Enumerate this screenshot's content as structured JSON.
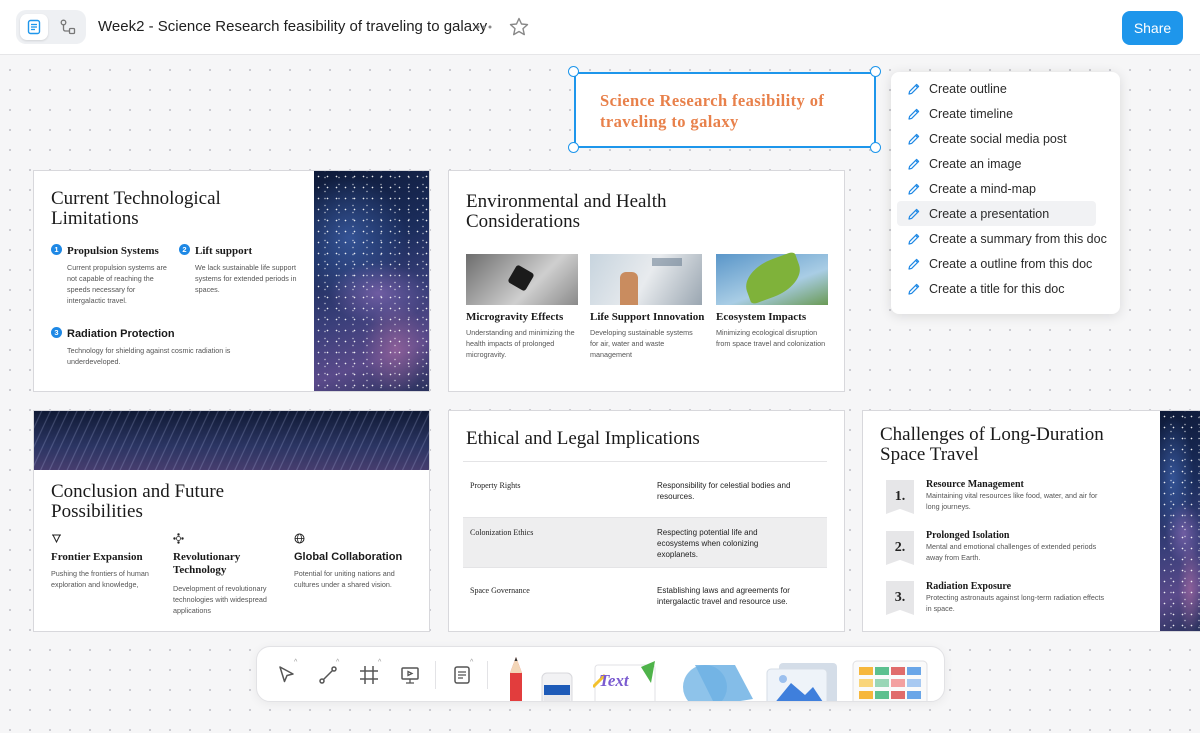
{
  "header": {
    "doc_title": "Week2 -  Science Research feasibility of traveling to galaxy",
    "share_label": "Share",
    "mode_icons": [
      "page-mode-icon",
      "edgeless-mode-icon"
    ],
    "more_icon": "more-horizontal-icon",
    "favorite_icon": "star-icon"
  },
  "canvas": {
    "selected_heading": "Science Research feasibility of traveling to galaxy"
  },
  "ai_menu": {
    "items": [
      "Create outline",
      "Create timeline",
      "Create social media post",
      "Create an image",
      "Create a mind-map",
      "Create a presentation",
      "Create a summary from this doc",
      "Create a outline from this doc",
      "Create a title for this doc"
    ],
    "hovered_index": 5,
    "item_icon": "pen-icon"
  },
  "slides": {
    "tech": {
      "title": "Current Technological Limitations",
      "items": [
        {
          "num": "1",
          "title": "Propulsion Systems",
          "body": "Current propulsion systems are not capable of reaching the speeds necessary for intergalactic travel."
        },
        {
          "num": "2",
          "title": "Lift support",
          "body": "We lack sustainable life support systems for extended periods in spaces."
        },
        {
          "num": "3",
          "title": "Radiation Protection",
          "body": "Technology for shielding against cosmic radiation is underdeveloped."
        }
      ]
    },
    "env": {
      "title": "Environmental and Health Considerations",
      "items": [
        {
          "title": "Microgravity Effects",
          "body": "Understanding and minimizing the health impacts of prolonged microgravity."
        },
        {
          "title": "Life Support Innovation",
          "body": "Developing sustainable systems for air, water and waste management"
        },
        {
          "title": "Ecosystem Impacts",
          "body": "Minimizing ecological disruption from space travel and colonization"
        }
      ]
    },
    "conclusion": {
      "title": "Conclusion and Future Possibilities",
      "items": [
        {
          "icon": "network-icon",
          "title": "Frontier Expansion",
          "body": "Pushing the frontiers of human exploration and knowledge,"
        },
        {
          "icon": "hexagon-nodes-icon",
          "title": "Revolutionary Technology",
          "body": "Development of revolutionary technologies with widespread applications"
        },
        {
          "icon": "globe-icon",
          "title": "Global Collaboration",
          "body": "Potential for uniting nations and cultures under a shared vision."
        }
      ]
    },
    "ethics": {
      "title": "Ethical and Legal Implications",
      "rows": [
        {
          "label": "Property Rights",
          "text": "Responsibility for celestial bodies and resources."
        },
        {
          "label": "Colonization Ethics",
          "text": "Respecting potential life and ecosystems when colonizing exoplanets."
        },
        {
          "label": "Space Governance",
          "text": "Establishing laws and agreements for intergalactic travel and resource use."
        }
      ]
    },
    "challenges": {
      "title": "Challenges of Long-Duration Space Travel",
      "items": [
        {
          "num": "1.",
          "title": "Resource Management",
          "body": "Maintaining vital resources like food, water, and air for long journeys."
        },
        {
          "num": "2.",
          "title": "Prolonged Isolation",
          "body": "Mental and emotional challenges of extended periods away from Earth."
        },
        {
          "num": "3.",
          "title": "Radiation Exposure",
          "body": "Protecting astronauts against long-term radiation effects in space."
        }
      ]
    }
  },
  "toolbar": {
    "tools": [
      "pointer-icon",
      "connector-icon",
      "frame-icon",
      "presentation-icon",
      "note-icon"
    ],
    "widgets": [
      "pen-pencil-widget",
      "eraser-widget",
      "text-widget",
      "shapes-widget",
      "media-widget",
      "templates-widget"
    ],
    "text_widget_label": "Text"
  }
}
